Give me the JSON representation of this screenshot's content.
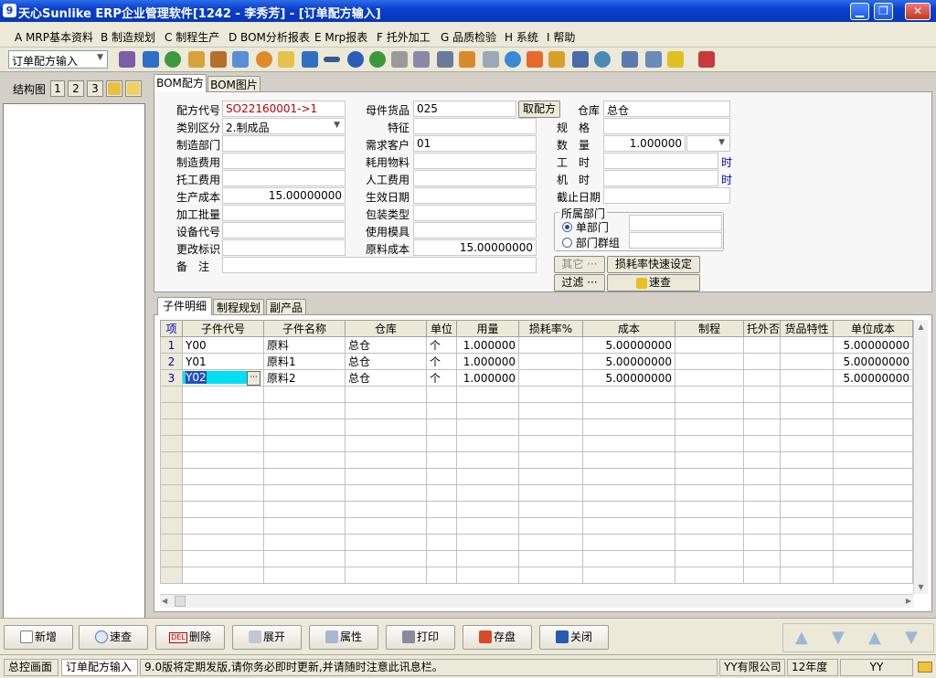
{
  "window": {
    "title": "天心Sunlike ERP企业管理软件[1242 - 李秀芳] - [订单配方输入]",
    "min": "▁",
    "max": "❐",
    "close": "✕",
    "app_icon": "9"
  },
  "menu": [
    {
      "label": "A MRP基本资料"
    },
    {
      "label": "B 制造规划"
    },
    {
      "label": "C 制程生产"
    },
    {
      "label": "D BOM分析报表"
    },
    {
      "label": "E Mrp报表"
    },
    {
      "label": "F 托外加工"
    },
    {
      "label": "G 品质检验"
    },
    {
      "label": "H 系统"
    },
    {
      "label": "I 帮助"
    }
  ],
  "toolbar": {
    "mode": "订单配方输入",
    "arrow": "▼"
  },
  "left": {
    "title": "结构图",
    "b1": "1",
    "b2": "2",
    "b3": "3"
  },
  "tabs": {
    "bom": "BOM配方",
    "bom_image": "BOM图片"
  },
  "form": {
    "recipe_code_label": "配方代号",
    "recipe_code": "SO22160001->1",
    "category_label": "类别区分",
    "category": "2.制成品",
    "dept_label": "制造部门",
    "dept": "",
    "mfg_cost_label": "制造费用",
    "mfg_cost": "",
    "outsource_cost_label": "托工费用",
    "outsource_cost": "",
    "prod_cost_label": "生产成本",
    "prod_cost": "15.00000000",
    "batch_label": "加工批量",
    "batch": "",
    "equip_label": "设备代号",
    "equip": "",
    "change_label": "更改标识",
    "change": "",
    "note_label": "备　注",
    "note": "",
    "parent_label": "母件货品",
    "parent": "025",
    "fetch_btn": "取配方",
    "feature_label": "特征",
    "feature": "",
    "customer_label": "需求客户",
    "customer": "01",
    "consume_label": "耗用物料",
    "consume": "",
    "labor_label": "人工费用",
    "labor": "",
    "effective_label": "生效日期",
    "effective": "",
    "package_label": "包装类型",
    "package": "",
    "mold_label": "使用模具",
    "mold": "",
    "material_cost_label": "原料成本",
    "material_cost": "15.00000000",
    "warehouse_label": "仓库",
    "warehouse": "总仓",
    "spec_label": "规　格",
    "spec": "",
    "qty_label": "数　量",
    "qty": "1.000000",
    "worktime_label": "工　时",
    "worktime": "",
    "worktime_unit": "时",
    "machinetime_label": "机　时",
    "machinetime": "",
    "machinetime_unit": "时",
    "deadline_label": "截止日期",
    "deadline": "",
    "dept_group_title": "所属部门",
    "single_dept": "单部门",
    "dept_group": "部门群组",
    "other_btn": "其它 ···",
    "loss_btn": "损耗率快速设定",
    "filter_btn": "过滤 ···",
    "quick_btn": "速查"
  },
  "subtabs": {
    "detail": "子件明细",
    "process": "制程规划",
    "byproduct": "副产品"
  },
  "grid": {
    "headers": [
      "项",
      "子件代号",
      "子件名称",
      "仓库",
      "单位",
      "用量",
      "损耗率%",
      "成本",
      "制程",
      "托外否",
      "货品特性",
      "单位成本"
    ],
    "rows": [
      [
        "1",
        "Y00",
        "原料",
        "总仓",
        "个",
        "1.000000",
        "",
        "5.00000000",
        "",
        "",
        "",
        "5.00000000"
      ],
      [
        "2",
        "Y01",
        "原料1",
        "总仓",
        "个",
        "1.000000",
        "",
        "5.00000000",
        "",
        "",
        "",
        "5.00000000"
      ],
      [
        "3",
        "Y02",
        "原料2",
        "总仓",
        "个",
        "1.000000",
        "",
        "5.00000000",
        "",
        "",
        "",
        "5.00000000"
      ]
    ],
    "ellipsis": "···"
  },
  "actions": {
    "add": "新增",
    "search": "速查",
    "delete": "删除",
    "expand": "展开",
    "props": "属性",
    "print": "打印",
    "save": "存盘",
    "close": "关闭",
    "del_icon": "DEL"
  },
  "status": {
    "home": "总控画面",
    "current": "订单配方输入",
    "message": "9.0版将定期发版,请你务必即时更新,并请随时注意此讯息栏。",
    "company": "YY有限公司",
    "year": "12年度",
    "user": "YY"
  }
}
